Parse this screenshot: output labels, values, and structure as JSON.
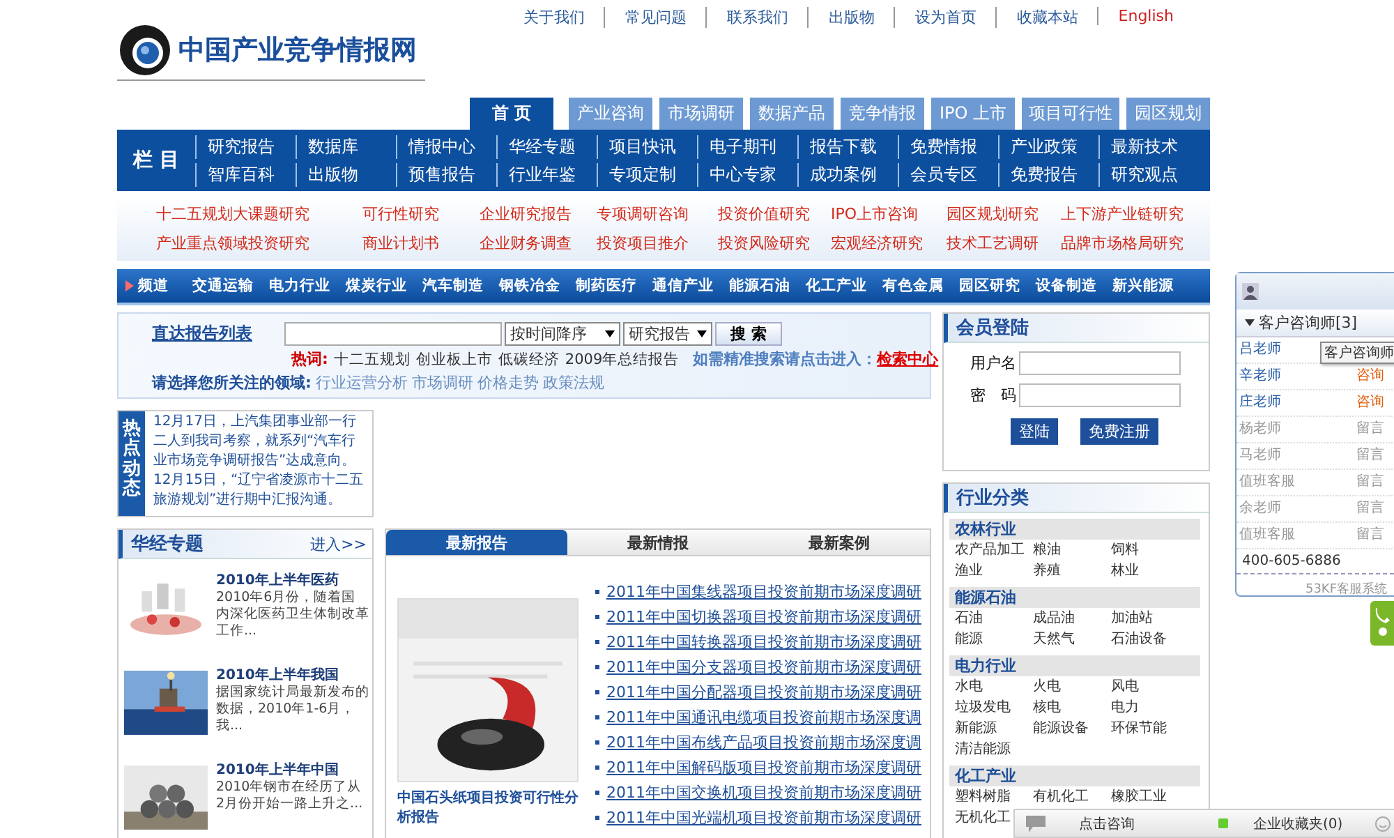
{
  "top_links": [
    {
      "label": "关于我们",
      "kind": "plain"
    },
    {
      "label": "常见问题",
      "kind": "plain"
    },
    {
      "label": "联系我们",
      "kind": "plain"
    },
    {
      "label": "出版物",
      "kind": "plain"
    },
    {
      "label": "设为首页",
      "kind": "plain"
    },
    {
      "label": "收藏本站",
      "kind": "plain"
    },
    {
      "label": "English",
      "kind": "accent"
    }
  ],
  "logo": {
    "title": "中国产业竞争情报网"
  },
  "nav_tabs": [
    {
      "label": "首 页",
      "selected": true
    },
    {
      "label": "产业咨询",
      "selected": false
    },
    {
      "label": "市场调研",
      "selected": false
    },
    {
      "label": "数据产品",
      "selected": false
    },
    {
      "label": "竞争情报",
      "selected": false
    },
    {
      "label": "IPO 上市",
      "selected": false
    },
    {
      "label": "项目可行性",
      "selected": false
    },
    {
      "label": "园区规划",
      "selected": false
    }
  ],
  "column_nav": {
    "label": "栏 目",
    "rows": [
      [
        "研究报告",
        "数据库",
        "情报中心",
        "华经专题",
        "项目快讯",
        "电子期刊",
        "报告下载",
        "免费情报",
        "产业政策",
        "最新技术"
      ],
      [
        "智库百科",
        "出版物",
        "预售报告",
        "行业年鉴",
        "专项定制",
        "中心专家",
        "成功案例",
        "会员专区",
        "免费报告",
        "研究观点"
      ]
    ]
  },
  "research_links": [
    [
      "十二五规划大课题研究",
      "可行性研究",
      "企业研究报告",
      "专项调研咨询",
      "投资价值研究",
      "IPO上市咨询",
      "园区规划研究",
      "上下游产业链研究"
    ],
    [
      "产业重点领域投资研究",
      "商业计划书",
      "企业财务调查",
      "投资项目推介",
      "投资风险研究",
      "宏观经济研究",
      "技术工艺调研",
      "品牌市场格局研究"
    ]
  ],
  "channel_bar": {
    "label": "频道",
    "items": [
      "交通运输",
      "电力行业",
      "煤炭行业",
      "汽车制造",
      "钢铁冶金",
      "制药医疗",
      "通信产业",
      "能源石油",
      "化工产业",
      "有色金属",
      "园区研究",
      "设备制造",
      "新兴能源"
    ]
  },
  "search": {
    "link": "直达报告列表",
    "sort": "按时间降序",
    "type": "研究报告",
    "button": "搜 索",
    "hot_label": "热词:",
    "hot_words": [
      "十二五规划",
      "创业板上市",
      "低碳经济",
      "2009年总结报告"
    ],
    "precise_text": "如需精准搜索请点击进入：",
    "precise_link": "检索中心",
    "domain_label": "请选择您所关注的领域:",
    "domains": [
      "行业运营分析",
      "市场调研",
      "价格走势",
      "政策法规"
    ]
  },
  "hot_news": {
    "label": "热点动态",
    "items": [
      "12月17日，上汽集团事业部一行二人到我司考察，就系列“汽车行业市场竞争调研报告”达成意向。",
      "12月15日，“辽宁省凌源市十二五旅游规划”进行期中汇报沟通。"
    ]
  },
  "topics": {
    "title": "华经专题",
    "more": "进入>>",
    "items": [
      {
        "kind": "picture",
        "title": "2010年上半年医药",
        "summary": "2010年6月份，随着国内深化医药卫生体制改革工作..."
      },
      {
        "kind": "picture",
        "title": "2010年上半年我国",
        "summary": "据国家统计局最新发布的数据，2010年1-6月，我..."
      },
      {
        "kind": "picture",
        "title": "2010年上半年中国",
        "summary": "2010年钢市在经历了从2月份开始一路上升之..."
      }
    ]
  },
  "report_tabs": [
    {
      "label": "最新报告",
      "selected": true
    },
    {
      "label": "最新情报",
      "selected": false
    },
    {
      "label": "最新案例",
      "selected": false
    }
  ],
  "feature": {
    "kind": "picture",
    "caption": "中国石头纸项目投资可行性分析报告"
  },
  "reports": [
    "2011年中国集线器项目投资前期市场深度调研",
    "2011年中国切换器项目投资前期市场深度调研",
    "2011年中国转换器项目投资前期市场深度调研",
    "2011年中国分支器项目投资前期市场深度调研",
    "2011年中国分配器项目投资前期市场深度调研",
    "2011年中国通讯电缆项目投资前期市场深度调",
    "2011年中国布线产品项目投资前期市场深度调",
    "2011年中国解码版项目投资前期市场深度调研",
    "2011年中国交换机项目投资前期市场深度调研",
    "2011年中国光端机项目投资前期市场深度调研"
  ],
  "login": {
    "title": "会员登陆",
    "username_label": "用户名",
    "password_label": "密　码",
    "login": "登陆",
    "register": "免费注册"
  },
  "categories": {
    "title": "行业分类",
    "groups": [
      {
        "name": "农林行业",
        "items": [
          "农产品加工",
          "粮油",
          "饲料",
          "渔业",
          "养殖",
          "林业"
        ]
      },
      {
        "name": "能源石油",
        "items": [
          "石油",
          "成品油",
          "加油站",
          "能源",
          "天然气",
          "石油设备"
        ]
      },
      {
        "name": "电力行业",
        "items": [
          "水电",
          "火电",
          "风电",
          "垃圾发电",
          "核电",
          "电力",
          "新能源",
          "能源设备",
          "环保节能",
          "清洁能源"
        ]
      },
      {
        "name": "化工产业",
        "items": [
          "塑料树脂",
          "有机化工",
          "橡胶工业",
          "无机化工"
        ]
      }
    ]
  },
  "chat": {
    "header": "客户咨询师[3]",
    "agents": [
      {
        "name": "吕老师",
        "online": true
      },
      {
        "name": "辛老师",
        "online": true,
        "action": "咨询"
      },
      {
        "name": "庄老师",
        "online": true,
        "action": "咨询"
      },
      {
        "name": "杨老师",
        "online": false,
        "action": "留言"
      },
      {
        "name": "马老师",
        "online": false,
        "action": "留言"
      },
      {
        "name": "值班客服",
        "online": false,
        "action": "留言"
      },
      {
        "name": "余老师",
        "online": false,
        "action": "留言"
      },
      {
        "name": "值班客服",
        "online": false,
        "action": "留言"
      }
    ],
    "phone": "400-605-6886",
    "footer": "53KF客服系统",
    "tooltip": "客户咨询师"
  },
  "chat_bar": {
    "consult": "点击咨询",
    "favorites": "企业收藏夹(0)"
  }
}
